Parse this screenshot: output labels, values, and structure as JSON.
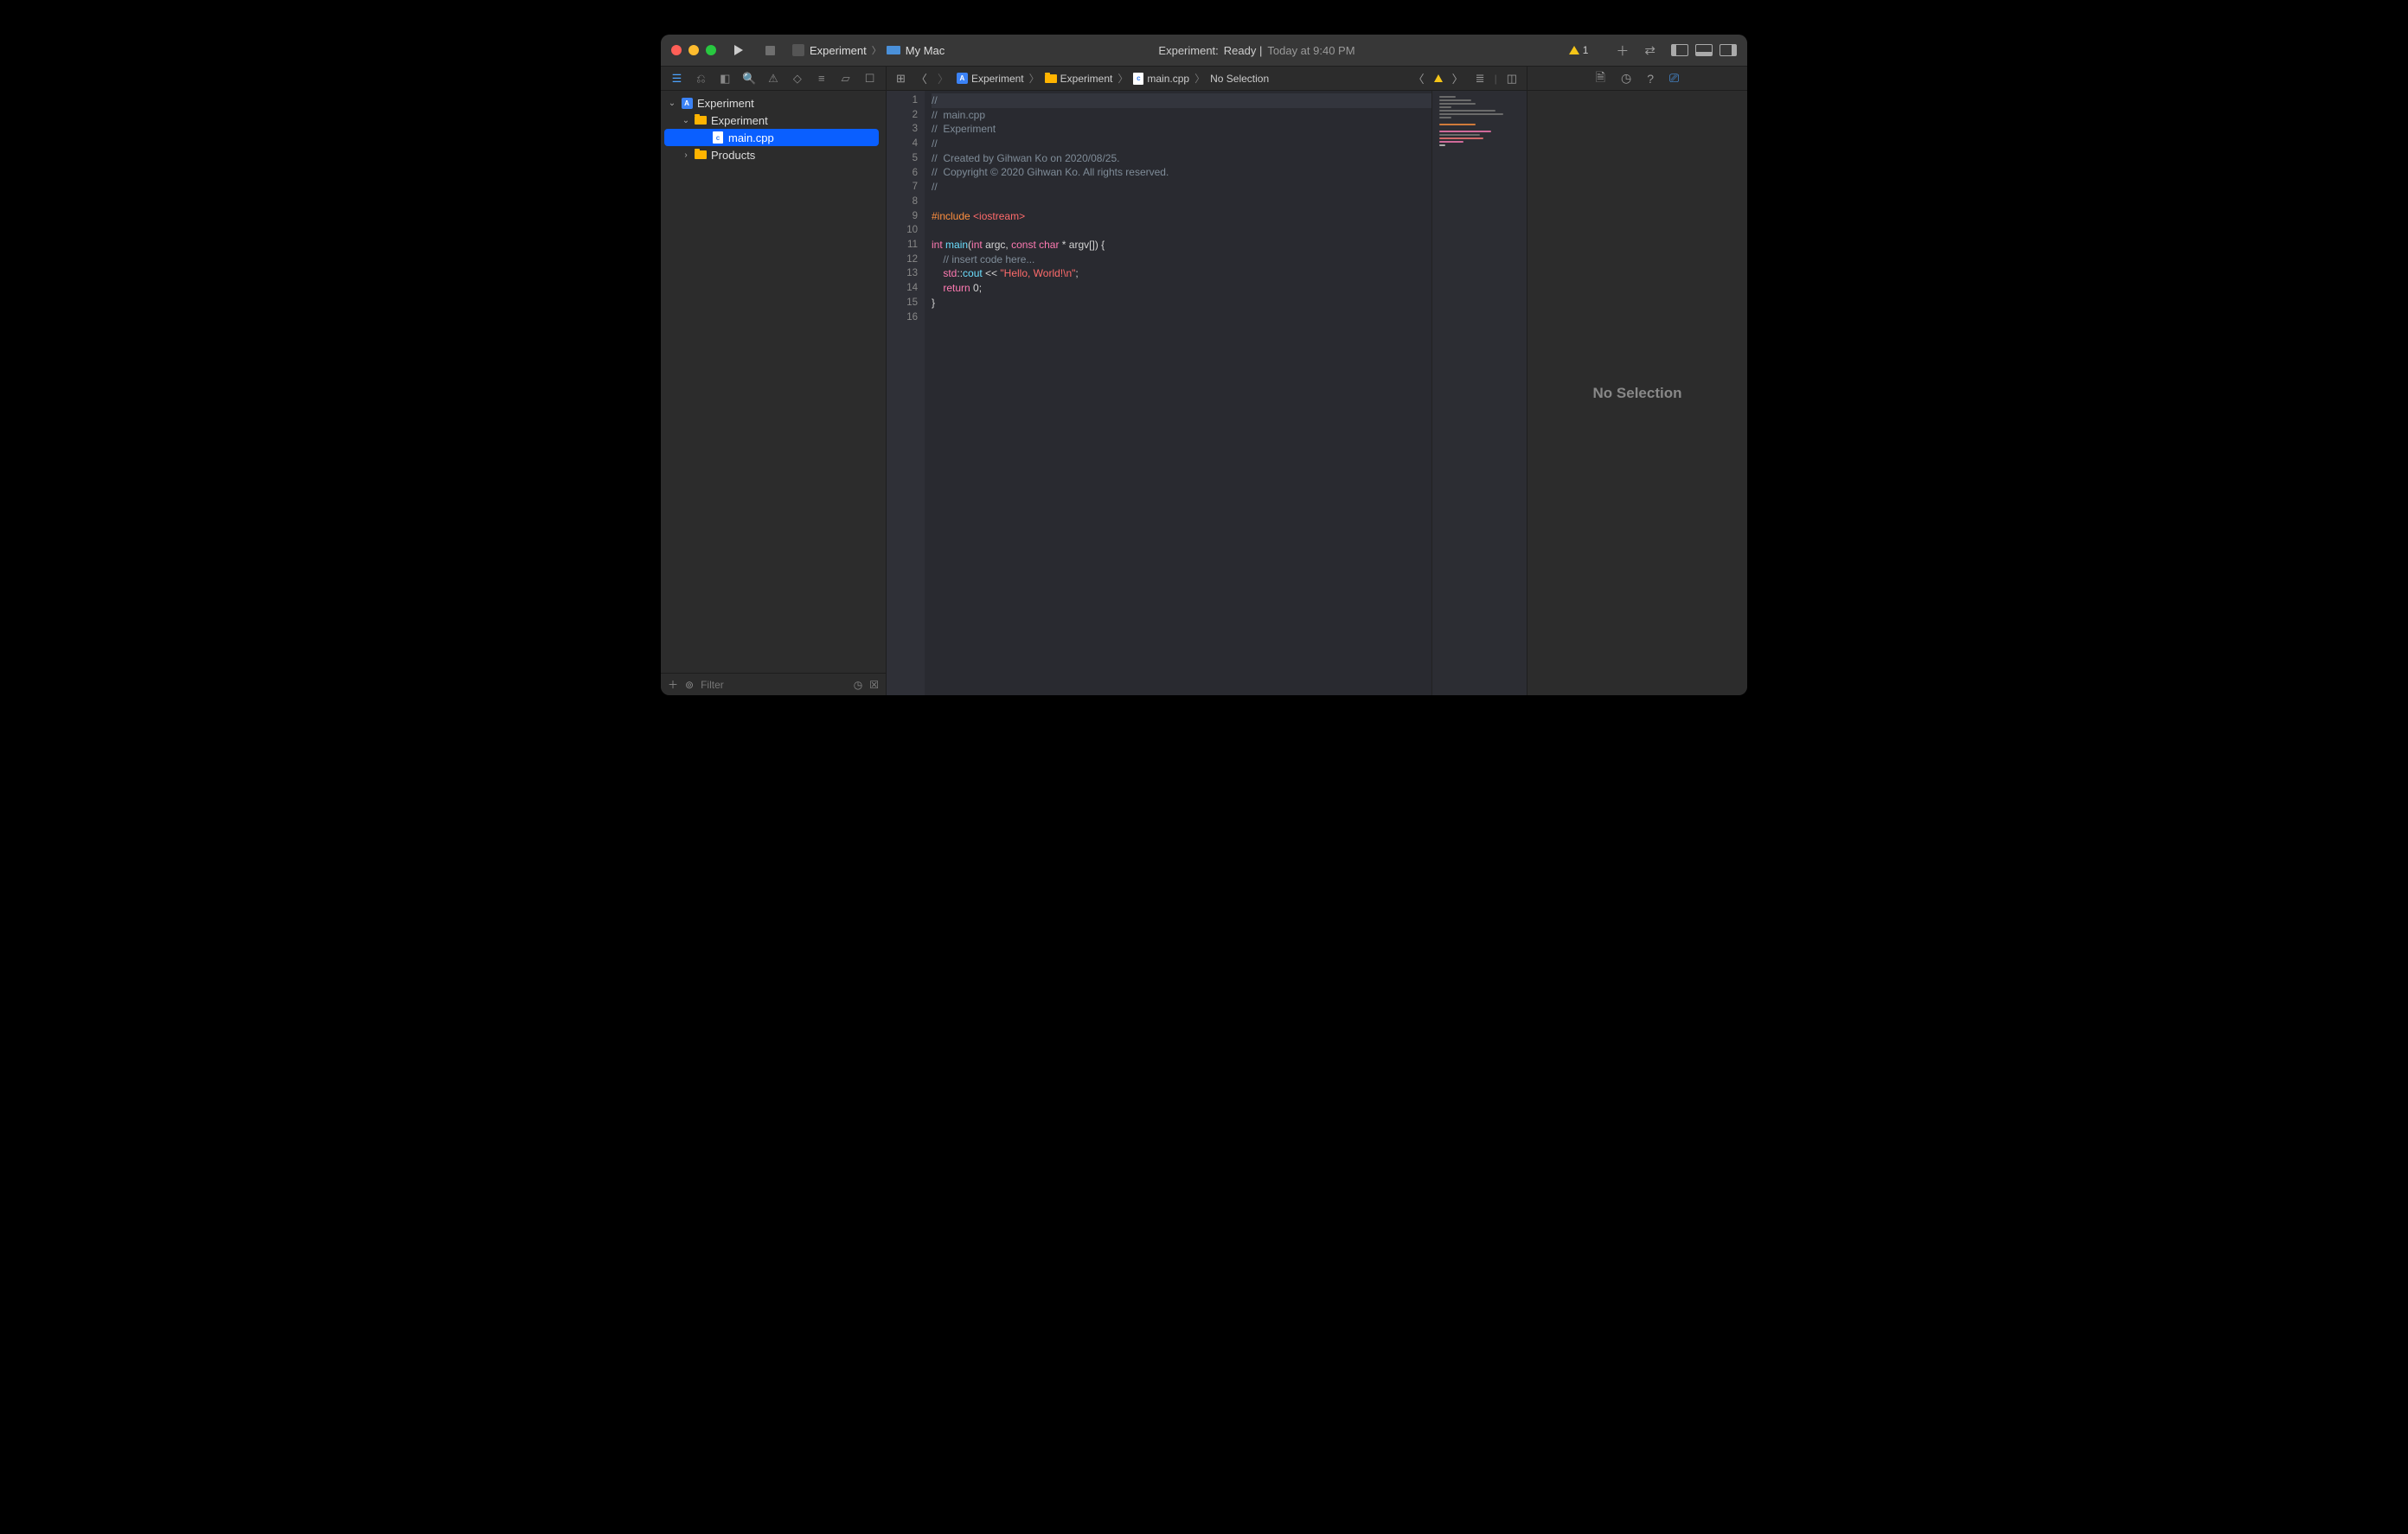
{
  "toolbar": {
    "scheme_name": "Experiment",
    "scheme_dest": "My Mac",
    "status_project": "Experiment:",
    "status_text": "Ready |",
    "status_time": "Today at 9:40 PM",
    "warning_count": "1"
  },
  "navigator": {
    "items": [
      {
        "indent": 0,
        "chev": "⌄",
        "icon": "xcode-project-icon",
        "label": "Experiment",
        "sel": false
      },
      {
        "indent": 1,
        "chev": "⌄",
        "icon": "folder-icon",
        "label": "Experiment",
        "sel": false
      },
      {
        "indent": 2,
        "chev": "",
        "icon": "cpp-file-icon",
        "label": "main.cpp",
        "sel": true
      },
      {
        "indent": 1,
        "chev": "›",
        "icon": "folder-icon",
        "label": "Products",
        "sel": false
      }
    ],
    "filter_placeholder": "Filter"
  },
  "jumpbar": {
    "crumbs": [
      "Experiment",
      "Experiment",
      "main.cpp",
      "No Selection"
    ]
  },
  "editor_jump_right": {
    "warn": ""
  },
  "code_lines": [
    {
      "n": 1,
      "cls": "hl-line",
      "tokens": [
        {
          "t": "//",
          "c": "comment"
        }
      ]
    },
    {
      "n": 2,
      "tokens": [
        {
          "t": "//  main.cpp",
          "c": "comment"
        }
      ]
    },
    {
      "n": 3,
      "tokens": [
        {
          "t": "//  Experiment",
          "c": "comment"
        }
      ]
    },
    {
      "n": 4,
      "tokens": [
        {
          "t": "//",
          "c": "comment"
        }
      ]
    },
    {
      "n": 5,
      "tokens": [
        {
          "t": "//  Created by Gihwan Ko on 2020/08/25.",
          "c": "comment"
        }
      ]
    },
    {
      "n": 6,
      "tokens": [
        {
          "t": "//  Copyright © 2020 Gihwan Ko. All rights reserved.",
          "c": "comment"
        }
      ]
    },
    {
      "n": 7,
      "tokens": [
        {
          "t": "//",
          "c": "comment"
        }
      ]
    },
    {
      "n": 8,
      "tokens": []
    },
    {
      "n": 9,
      "tokens": [
        {
          "t": "#include ",
          "c": "preproc"
        },
        {
          "t": "<iostream>",
          "c": "incstr"
        }
      ]
    },
    {
      "n": 10,
      "tokens": []
    },
    {
      "n": 11,
      "tokens": [
        {
          "t": "int",
          "c": "kw"
        },
        {
          "t": " ",
          "c": ""
        },
        {
          "t": "main",
          "c": "fn"
        },
        {
          "t": "(",
          "c": ""
        },
        {
          "t": "int",
          "c": "kw"
        },
        {
          "t": " argc, ",
          "c": ""
        },
        {
          "t": "const",
          "c": "kw"
        },
        {
          "t": " ",
          "c": ""
        },
        {
          "t": "char",
          "c": "kw"
        },
        {
          "t": " * argv[]) {",
          "c": ""
        }
      ]
    },
    {
      "n": 12,
      "tokens": [
        {
          "t": "    // insert code here...",
          "c": "comment"
        }
      ]
    },
    {
      "n": 13,
      "tokens": [
        {
          "t": "    ",
          "c": ""
        },
        {
          "t": "std",
          "c": "ns"
        },
        {
          "t": "::",
          "c": ""
        },
        {
          "t": "cout",
          "c": "mem"
        },
        {
          "t": " << ",
          "c": ""
        },
        {
          "t": "\"Hello, World!\\n\"",
          "c": "str"
        },
        {
          "t": ";",
          "c": ""
        }
      ]
    },
    {
      "n": 14,
      "tokens": [
        {
          "t": "    ",
          "c": ""
        },
        {
          "t": "return",
          "c": "kw"
        },
        {
          "t": " 0;",
          "c": ""
        }
      ]
    },
    {
      "n": 15,
      "tokens": [
        {
          "t": "}",
          "c": ""
        }
      ]
    },
    {
      "n": 16,
      "tokens": []
    }
  ],
  "inspector": {
    "empty_text": "No Selection"
  }
}
